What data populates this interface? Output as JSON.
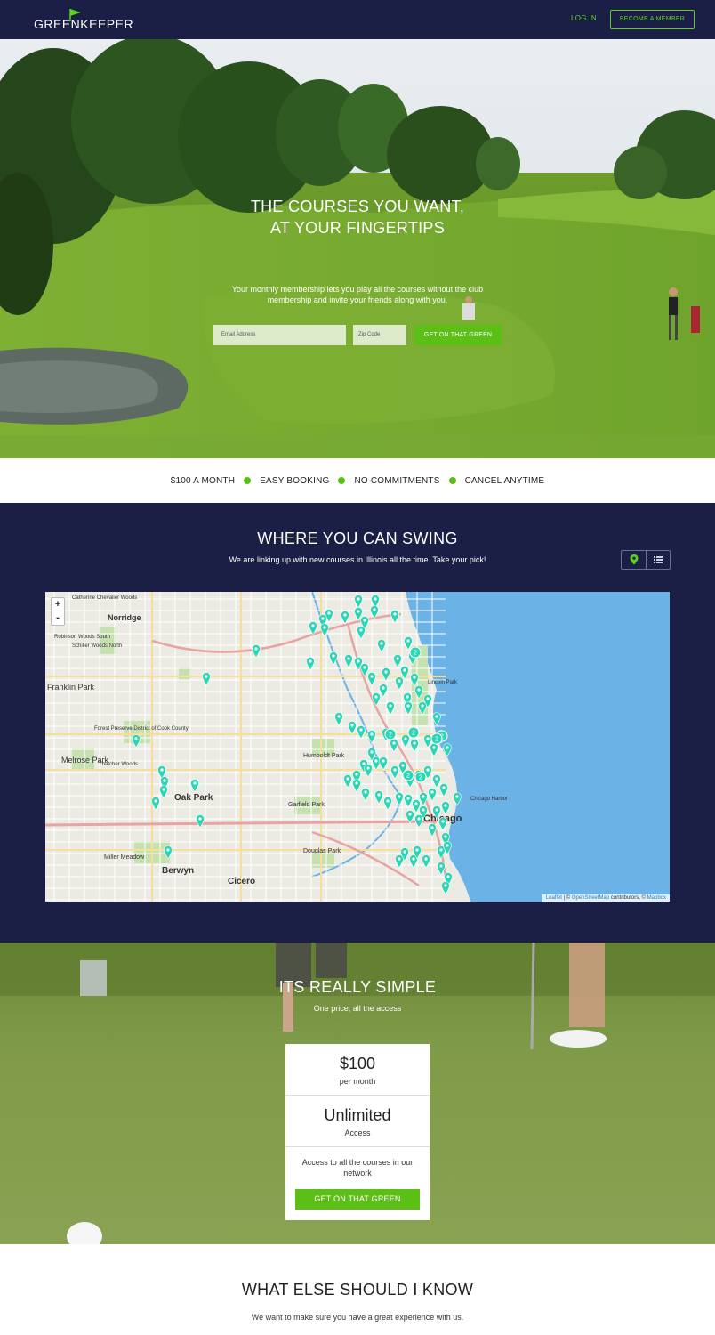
{
  "nav": {
    "logo_text": "GREENKEEPER",
    "login_label": "LOG IN",
    "member_label": "BECOME A MEMBER"
  },
  "hero": {
    "title_line1": "THE COURSES YOU WANT,",
    "title_line2": "AT YOUR FINGERTIPS",
    "subtitle": "Your monthly membership lets you play all the courses without the club membership and invite your friends along with you.",
    "email_placeholder": "Email Address",
    "zip_placeholder": "Zip Code",
    "cta_label": "GET ON THAT GREEN"
  },
  "features": [
    "$100 A MONTH",
    "EASY BOOKING",
    "NO COMMITMENTS",
    "CANCEL ANYTIME"
  ],
  "swing": {
    "title": "WHERE YOU CAN SWING",
    "subtitle": "We are linking up with new courses in Illinois all the time. Take your pick!",
    "toggle_icons": [
      "map-pin-icon",
      "list-icon"
    ],
    "zoom_in": "+",
    "zoom_out": "-",
    "attribution_leaflet": "Leaflet",
    "attribution_mid": " | © ",
    "attribution_osm": "OpenStreetMap",
    "attribution_contrib": " contributors, © ",
    "attribution_mapbox": "Mapbox",
    "map_labels": [
      "Norridge",
      "Franklin Park",
      "Melrose Park",
      "Oak Park",
      "Berwyn",
      "Cicero",
      "Chicago",
      "Humboldt Park",
      "Douglas Park",
      "Garfield Park",
      "Miller Meadow",
      "Forest Preserve District of Cook County",
      "Robinson Woods South",
      "Schiller Woods North",
      "Thatcher Woods",
      "Catherine Chevalier Woods",
      "Chicago Harbor",
      "Lincoln Park"
    ],
    "cluster_labels": [
      "2",
      "2",
      "2",
      "2",
      "2",
      "2",
      "2"
    ]
  },
  "simple": {
    "title": "ITS REALLY SIMPLE",
    "subtitle": "One price, all the access",
    "price": "$100",
    "price_period": "per month",
    "access_big": "Unlimited",
    "access_small": "Access",
    "description": "Access to all the courses in our network",
    "cta_label": "GET ON THAT GREEN"
  },
  "know": {
    "title": "WHAT ELSE SHOULD I KNOW",
    "subtitle": "We want to make sure you have a great experience with us."
  },
  "colors": {
    "navy": "#1c1f45",
    "green": "#5bbf16",
    "accent_green": "#5bd021",
    "pin_teal": "#2cd5b5",
    "lake": "#6bb3e6"
  }
}
